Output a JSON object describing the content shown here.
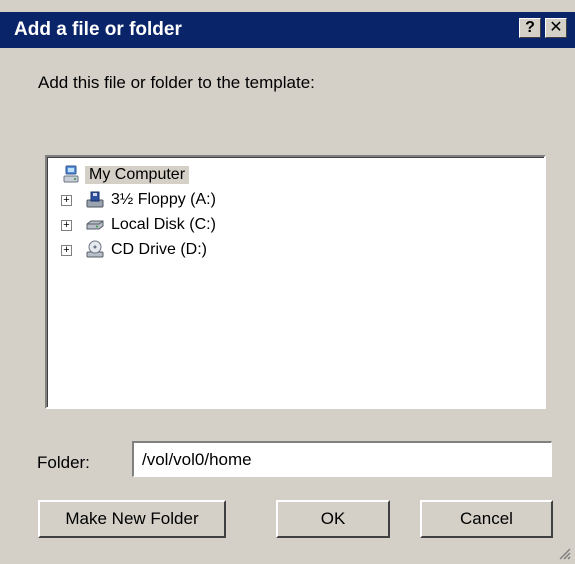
{
  "window": {
    "title": "Add a file or folder",
    "help_button": "?",
    "close_button": "✕"
  },
  "prompt": "Add this file or folder to the template:",
  "tree": {
    "root": {
      "label": "My Computer",
      "icon": "my-computer-icon",
      "selected": true
    },
    "items": [
      {
        "label": "3½ Floppy (A:)",
        "icon": "floppy-drive-icon",
        "expander": "+"
      },
      {
        "label": "Local Disk (C:)",
        "icon": "hard-disk-icon",
        "expander": "+"
      },
      {
        "label": "CD Drive (D:)",
        "icon": "cd-drive-icon",
        "expander": "+"
      }
    ]
  },
  "folder": {
    "label": "Folder:",
    "value": "/vol/vol0/home"
  },
  "buttons": {
    "make_new_folder": "Make New Folder",
    "ok": "OK",
    "cancel": "Cancel"
  },
  "colors": {
    "titlebar": "#0a246a",
    "dialog_face": "#d4d0c8"
  }
}
